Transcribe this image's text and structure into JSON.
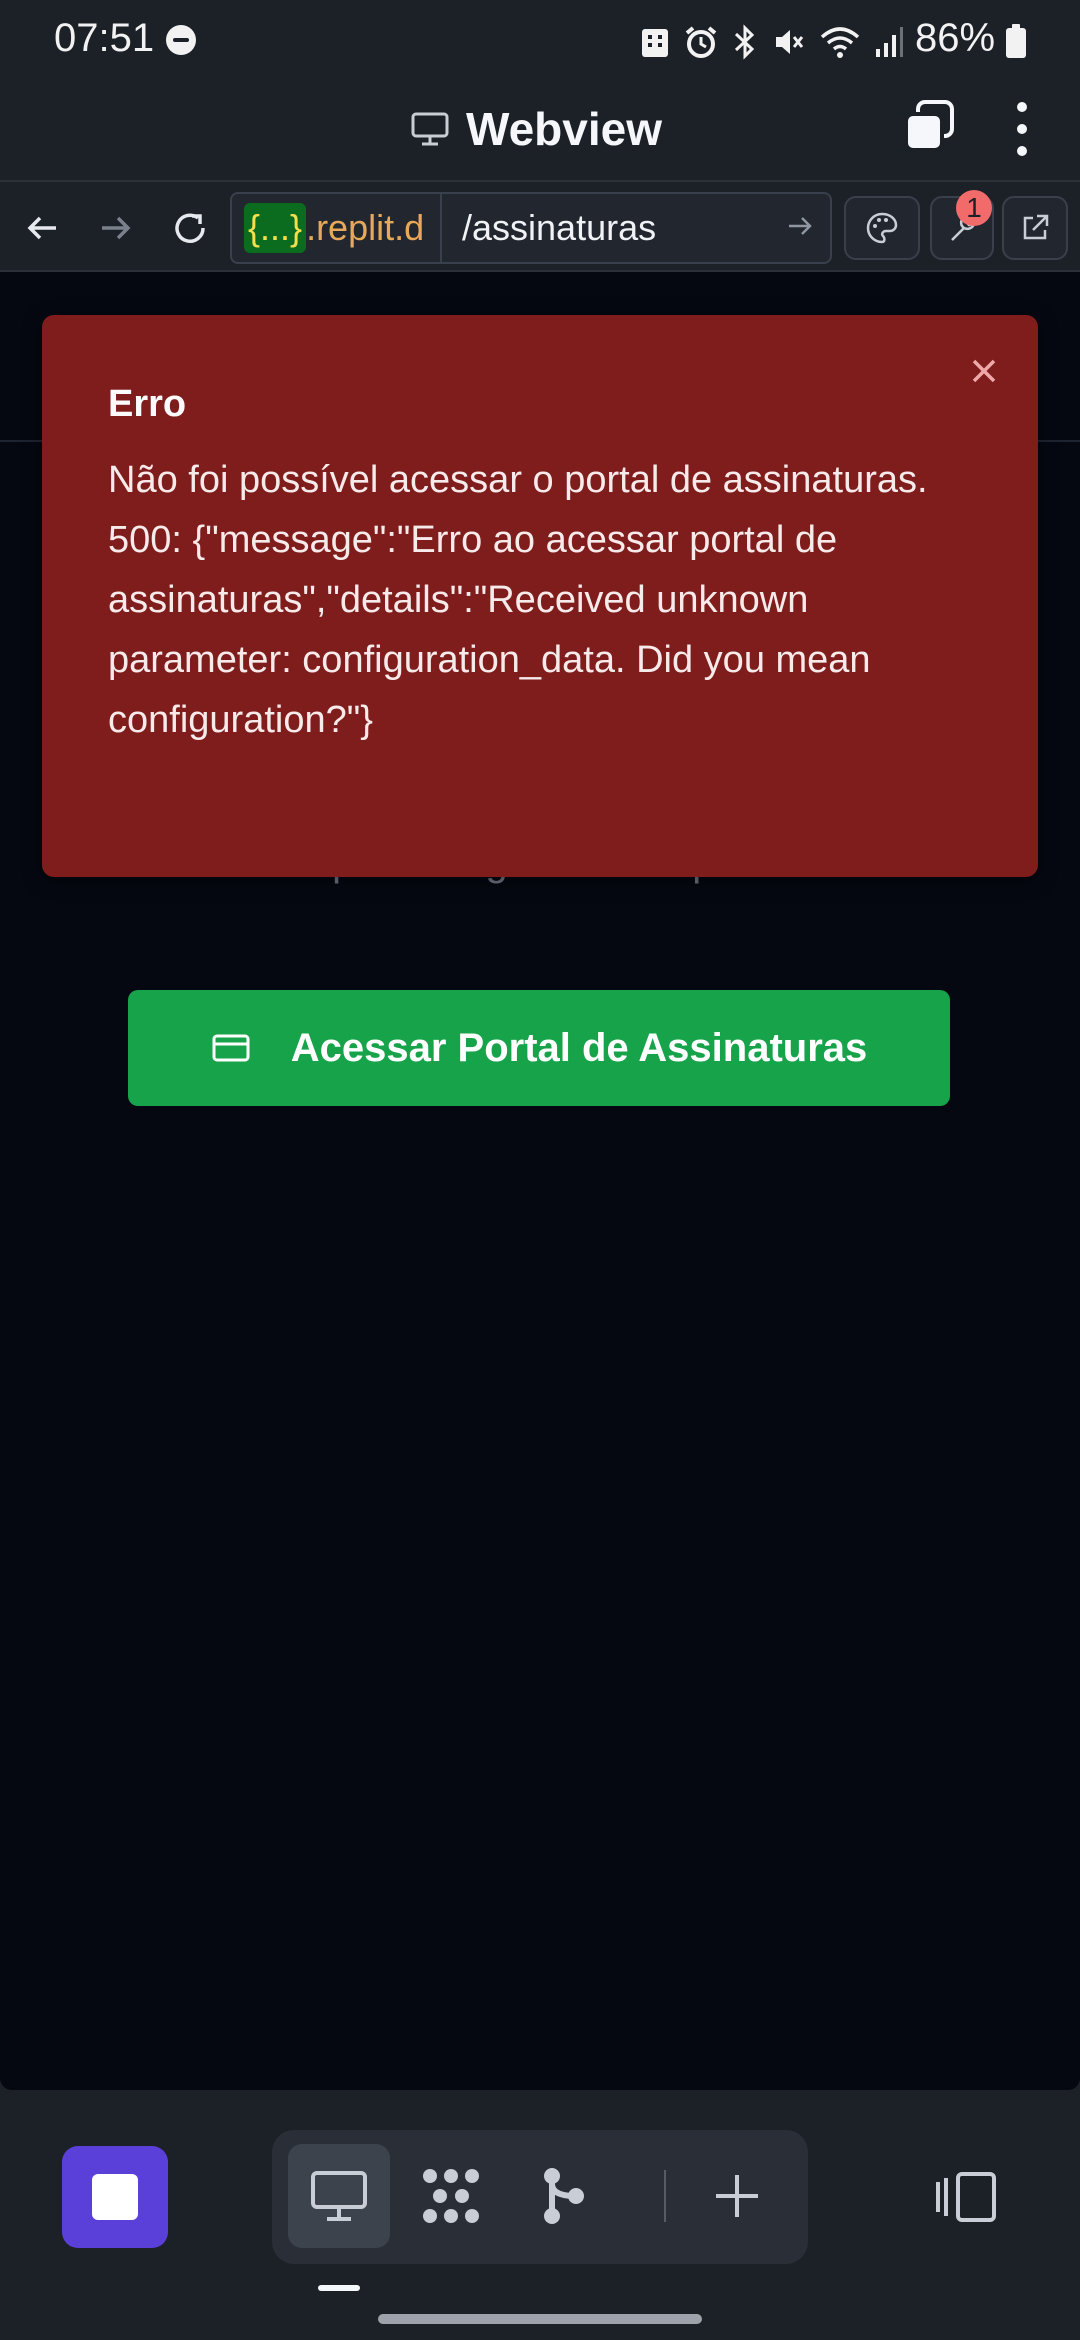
{
  "status_bar": {
    "time": "07:51",
    "battery": "86%",
    "icons": [
      "dnd-icon",
      "building-icon",
      "alarm-icon",
      "bluetooth-icon",
      "mute-icon",
      "wifi-icon",
      "signal-icon",
      "battery-icon"
    ]
  },
  "title_bar": {
    "title": "Webview",
    "icon": "monitor-icon"
  },
  "url_bar": {
    "host_mask": "{...}",
    "host_suffix": ".replit.d",
    "path": "/assinaturas",
    "devtools_badge": "1"
  },
  "page": {
    "behind_text": "portal seguro do Stripe.",
    "portal_button_label": "Acessar Portal de Assinaturas"
  },
  "toast": {
    "title": "Erro",
    "message": "Não foi possível acessar o portal de assinaturas. 500: {\"message\":\"Erro ao acessar portal de assinaturas\",\"details\":\"Received unknown parameter: configuration_data. Did you mean configuration?\"}"
  },
  "colors": {
    "toast_bg": "#7f1d1d",
    "button_green": "#17a34a",
    "stop_purple": "#5b3fd9",
    "page_bg": "#050811"
  }
}
